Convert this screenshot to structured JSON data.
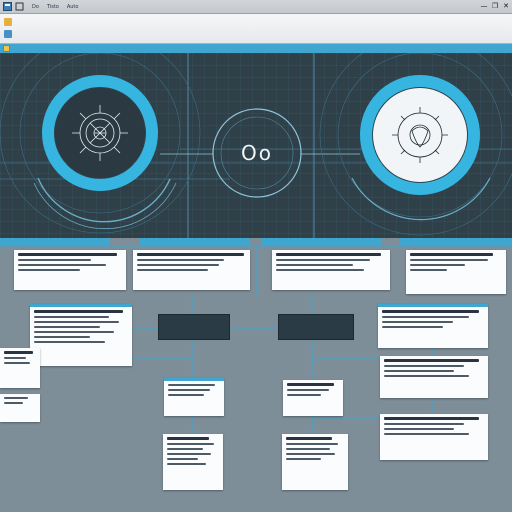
{
  "window": {
    "menu": [
      "Do",
      "Tisto",
      "Auto"
    ],
    "controls": [
      "—",
      "❐",
      "✕"
    ]
  },
  "ribbon": {
    "buttons": [
      {
        "label": "",
        "icon": "save-icon"
      },
      {
        "label": "",
        "icon": "folder-icon"
      }
    ]
  },
  "tabstrip": {
    "label": ""
  },
  "panel": {
    "title": "",
    "subtitle": "",
    "center_glyph": "Oo",
    "center_caption": ""
  },
  "columns": [
    {
      "label": ""
    },
    {
      "label": ""
    },
    {
      "label": ""
    },
    {
      "label": ""
    }
  ],
  "hubs": [
    {
      "line1": "",
      "line2": ""
    },
    {
      "line1": "",
      "line2": ""
    }
  ],
  "colors": {
    "accent": "#3fa6cf",
    "panel_bg": "#2f4049",
    "canvas_bg": "#7e8e98",
    "card_bg": "#fbfcfd"
  }
}
